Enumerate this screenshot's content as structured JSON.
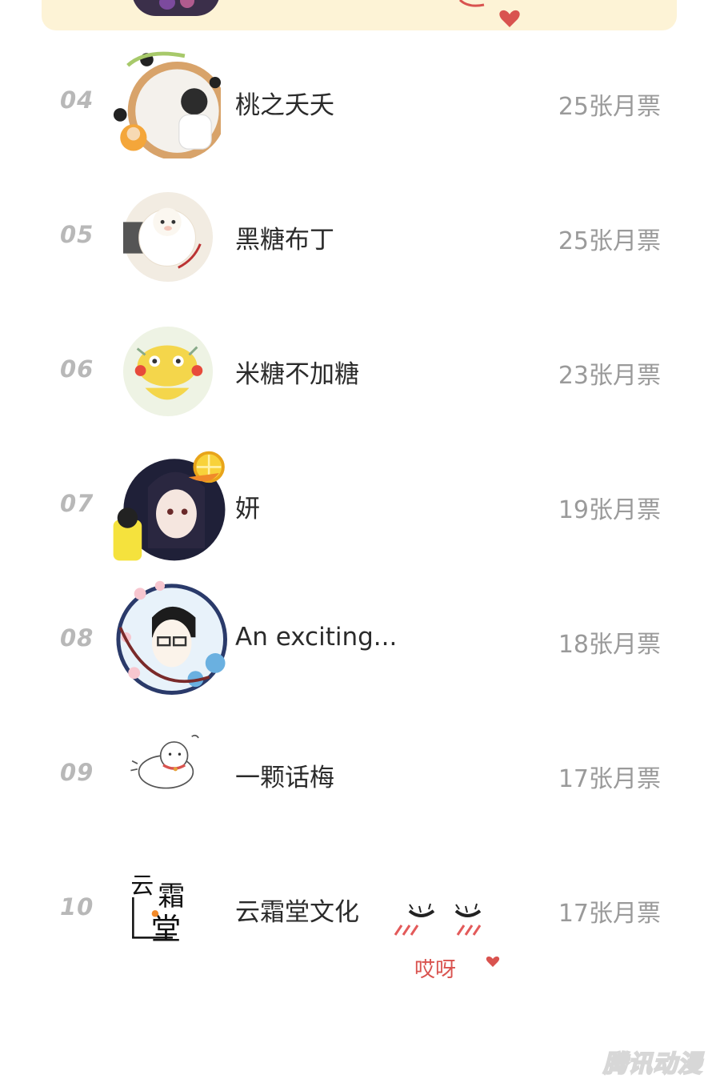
{
  "leaderboard": {
    "rows": [
      {
        "rank": "04",
        "name": "桃之夭夭",
        "votes": "25张月票",
        "avatar_icon": "forest-birds-avatar-icon"
      },
      {
        "rank": "05",
        "name": "黑糖布丁",
        "votes": "25张月票",
        "avatar_icon": "alpaca-avatar-icon"
      },
      {
        "rank": "06",
        "name": "米糖不加糖",
        "votes": "23张月票",
        "avatar_icon": "yellow-duck-avatar-icon"
      },
      {
        "rank": "07",
        "name": "妍",
        "votes": "19张月票",
        "avatar_icon": "anime-girl-lemon-avatar-icon"
      },
      {
        "rank": "08",
        "name": "An exciting...",
        "votes": "18张月票",
        "avatar_icon": "sakura-glasses-man-avatar-icon"
      },
      {
        "rank": "09",
        "name": "一颗话梅",
        "votes": "17张月票",
        "avatar_icon": "white-cat-avatar-icon"
      },
      {
        "rank": "10",
        "name": "云霜堂文化",
        "votes": "17张月票",
        "avatar_icon": "yunshuangtang-logo-icon"
      }
    ]
  },
  "decoration": {
    "sticker_text": "哎呀"
  },
  "watermark": {
    "text": "腾讯动漫"
  },
  "colors": {
    "banner": "#fdf3d6",
    "rank": "#b8b8b8",
    "name": "#2b2b2b",
    "votes": "#9a9a9a"
  }
}
